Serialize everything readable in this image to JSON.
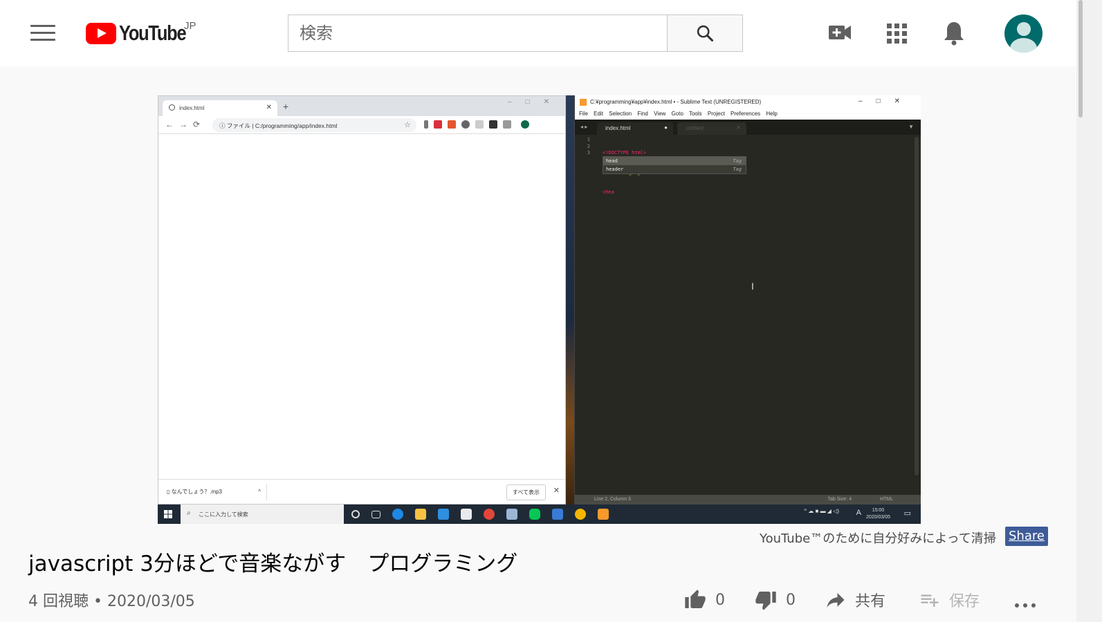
{
  "header": {
    "logo_text": "YouTube",
    "region": "JP",
    "search_placeholder": "検索"
  },
  "video": {
    "chrome": {
      "tab_title": "index.html",
      "address_label": "ファイル",
      "address_url": "C:/programming/app/index.html",
      "download_file": "なんでしょう？.mp3",
      "show_all": "すべて表示"
    },
    "sublime": {
      "window_title": "C:¥programming¥app¥index.html • - Sublime Text (UNREGISTERED)",
      "menu": [
        "File",
        "Edit",
        "Selection",
        "Find",
        "View",
        "Goto",
        "Tools",
        "Project",
        "Preferences",
        "Help"
      ],
      "tab_active": "index.html",
      "tab_inactive": "untitled",
      "line_numbers": [
        "1",
        "2",
        "3"
      ],
      "code_line1": "<!DOCTYPE html>",
      "code_line2_tag": "<html",
      "code_line2_attr": " lang=",
      "code_line2_str": "\"ja\"",
      "code_line2_end": ">",
      "code_line3": "<hea",
      "autocomplete": [
        {
          "name": "head",
          "kind": "Tag"
        },
        {
          "name": "header",
          "kind": "Tag"
        }
      ],
      "status_left": "Line 2, Column 3",
      "status_tab": "Tab Size: 4",
      "status_syntax": "HTML"
    },
    "taskbar": {
      "search_placeholder": "ここに入力して検索",
      "time": "15:00",
      "date": "2020/03/05",
      "ime": "A"
    }
  },
  "credit": {
    "text": "YouTube™のために自分好みによって清掃",
    "share_label": "Share"
  },
  "title": "javascript 3分ほどで音楽ながす　プログラミング",
  "meta": "4 回視聴 • 2020/03/05",
  "actions": {
    "likes": "0",
    "dislikes": "0",
    "share": "共有",
    "save": "保存"
  }
}
